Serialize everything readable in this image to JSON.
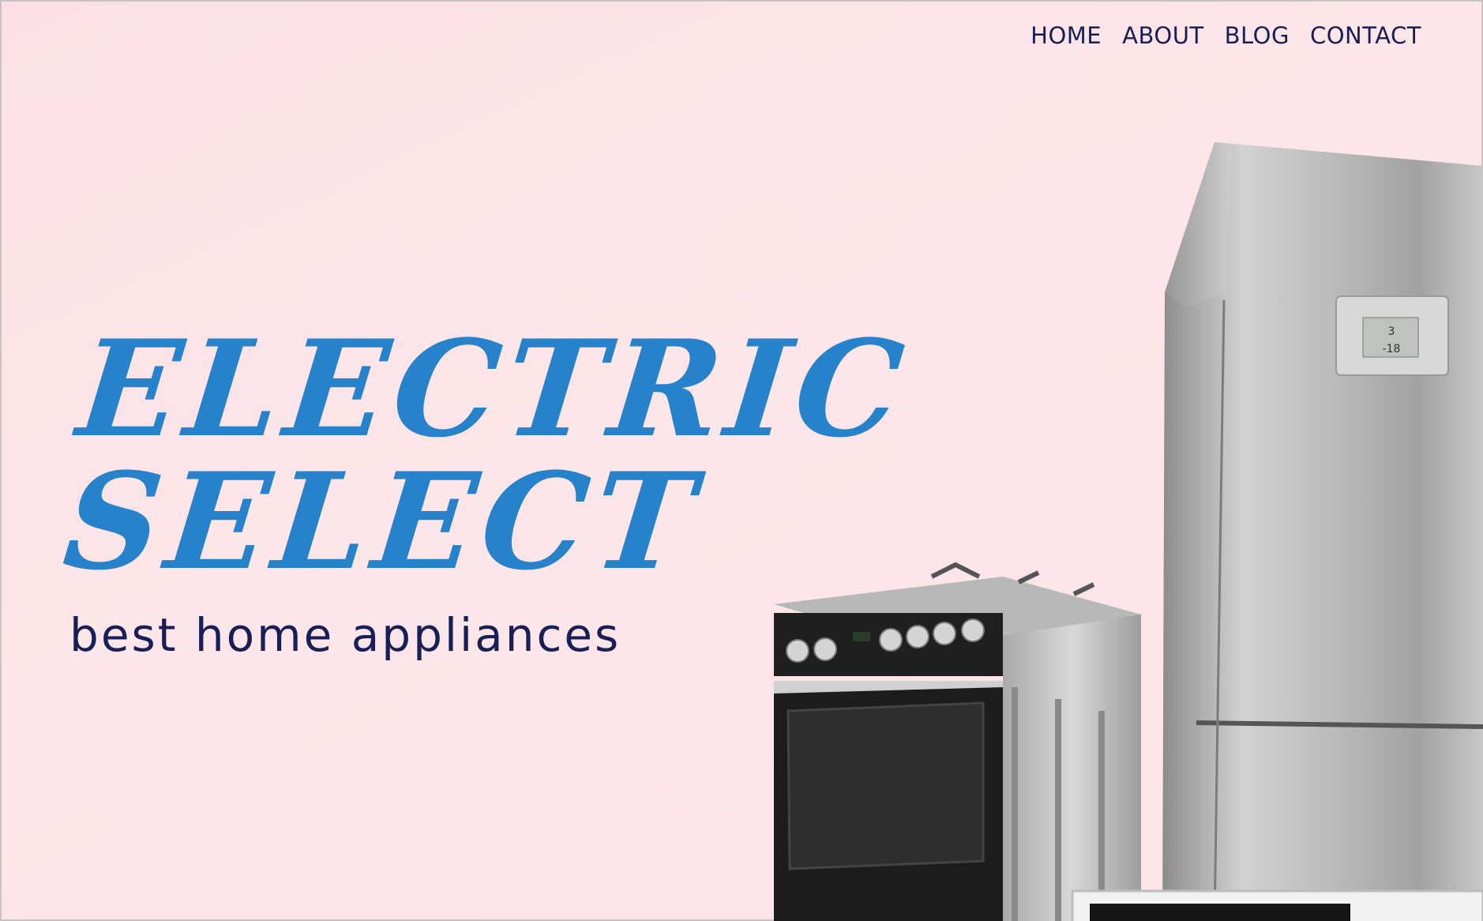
{
  "nav": {
    "items": [
      {
        "label": "HOME"
      },
      {
        "label": "ABOUT"
      },
      {
        "label": "BLOG"
      },
      {
        "label": "CONTACT"
      }
    ]
  },
  "hero": {
    "title_line1": "ELECTRIC",
    "title_line2": "SELECT",
    "tagline": "best home appliances"
  },
  "colors": {
    "background": "#fbe1e5",
    "title": "#2582cb",
    "nav_text": "#171f56"
  },
  "fridge_display": {
    "top_value": "3",
    "bottom_value": "-18"
  }
}
